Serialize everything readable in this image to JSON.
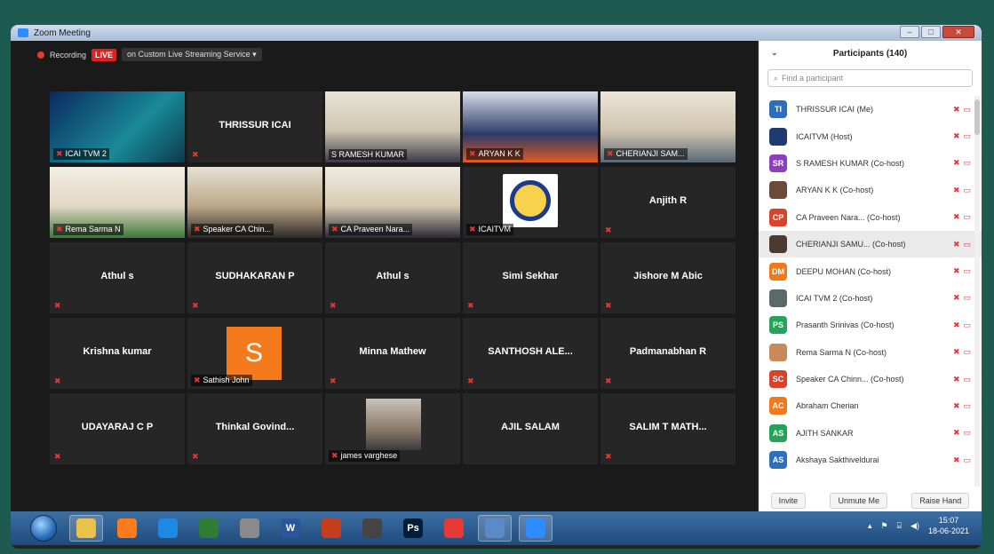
{
  "window": {
    "title": "Zoom Meeting",
    "controls": [
      "–",
      "□",
      "✕"
    ]
  },
  "recording": {
    "label": "Recording",
    "live": "LIVE",
    "stream": "on Custom Live Streaming Service"
  },
  "tiles": [
    {
      "name": "ICAI TVM 2",
      "kind": "video"
    },
    {
      "name": "THRISSUR ICAI",
      "kind": "name"
    },
    {
      "name": "S RAMESH KUMAR",
      "kind": "video"
    },
    {
      "name": "ARYAN K K",
      "kind": "video"
    },
    {
      "name": "CHERIANJI SAM...",
      "kind": "video"
    },
    {
      "name": "Rema Sarma N",
      "kind": "video"
    },
    {
      "name": "Speaker CA Chin...",
      "kind": "video"
    },
    {
      "name": "CA Praveen Nara...",
      "kind": "video"
    },
    {
      "name": "ICAITVM",
      "kind": "video"
    },
    {
      "name": "Anjith R",
      "kind": "name"
    },
    {
      "name": "Athul s",
      "kind": "name"
    },
    {
      "name": "SUDHAKARAN P",
      "kind": "name"
    },
    {
      "name": "Athul s",
      "kind": "name"
    },
    {
      "name": "Simi Sekhar",
      "kind": "name"
    },
    {
      "name": "Jishore M Abic",
      "kind": "name"
    },
    {
      "name": "Krishna kumar",
      "kind": "name"
    },
    {
      "name": "Sathish John",
      "kind": "avatar",
      "letter": "S"
    },
    {
      "name": "Minna Mathew",
      "kind": "name"
    },
    {
      "name": "SANTHOSH ALE...",
      "kind": "name"
    },
    {
      "name": "Padmanabhan R",
      "kind": "name"
    },
    {
      "name": "UDAYARAJ C P",
      "kind": "name"
    },
    {
      "name": "Thinkal Govind...",
      "kind": "name"
    },
    {
      "name": "james varghese",
      "kind": "video"
    },
    {
      "name": "AJIL SALAM",
      "kind": "name"
    },
    {
      "name": "SALIM T MATH...",
      "kind": "name"
    }
  ],
  "participants_panel": {
    "title": "Participants (140)",
    "search_placeholder": "Find a participant",
    "participants": [
      {
        "initials": "TI",
        "color": "#2d6fbd",
        "name": "THRISSUR ICAI (Me)"
      },
      {
        "initials": "",
        "color": "#1e3a6e",
        "name": "ICAITVM (Host)"
      },
      {
        "initials": "SR",
        "color": "#8e3fc0",
        "name": "S RAMESH KUMAR (Co-host)"
      },
      {
        "initials": "",
        "color": "#6b4a3a",
        "name": "ARYAN K K (Co-host)"
      },
      {
        "initials": "CP",
        "color": "#d9432c",
        "name": "CA Praveen Nara... (Co-host)"
      },
      {
        "initials": "",
        "color": "#4a3a30",
        "name": "CHERIANJI SAMU... (Co-host)"
      },
      {
        "initials": "DM",
        "color": "#f07a1a",
        "name": "DEEPU MOHAN (Co-host)"
      },
      {
        "initials": "",
        "color": "#5a6a6a",
        "name": "ICAI TVM 2 (Co-host)"
      },
      {
        "initials": "PS",
        "color": "#25a35a",
        "name": "Prasanth Srinivas (Co-host)"
      },
      {
        "initials": "",
        "color": "#c88a5a",
        "name": "Rema Sarma N (Co-host)"
      },
      {
        "initials": "SC",
        "color": "#d9432c",
        "name": "Speaker CA Chinn... (Co-host)"
      },
      {
        "initials": "AC",
        "color": "#f07a1a",
        "name": "Abraham Cherian"
      },
      {
        "initials": "AS",
        "color": "#25a35a",
        "name": "AJITH SANKAR"
      },
      {
        "initials": "AS",
        "color": "#2d6fbd",
        "name": "Akshaya Sakthiveldurai"
      }
    ],
    "buttons": {
      "invite": "Invite",
      "unmute": "Unmute Me",
      "raise_hand": "Raise Hand"
    }
  },
  "taskbar": {
    "apps": [
      "Explorer",
      "Firefox",
      "Edge",
      "Excel",
      "Paint",
      "W",
      "PowerPoint",
      "Wallet",
      "Ps",
      "Chrome",
      "Files",
      "Zoom"
    ],
    "time": "15:07",
    "date": "18-06-2021"
  }
}
